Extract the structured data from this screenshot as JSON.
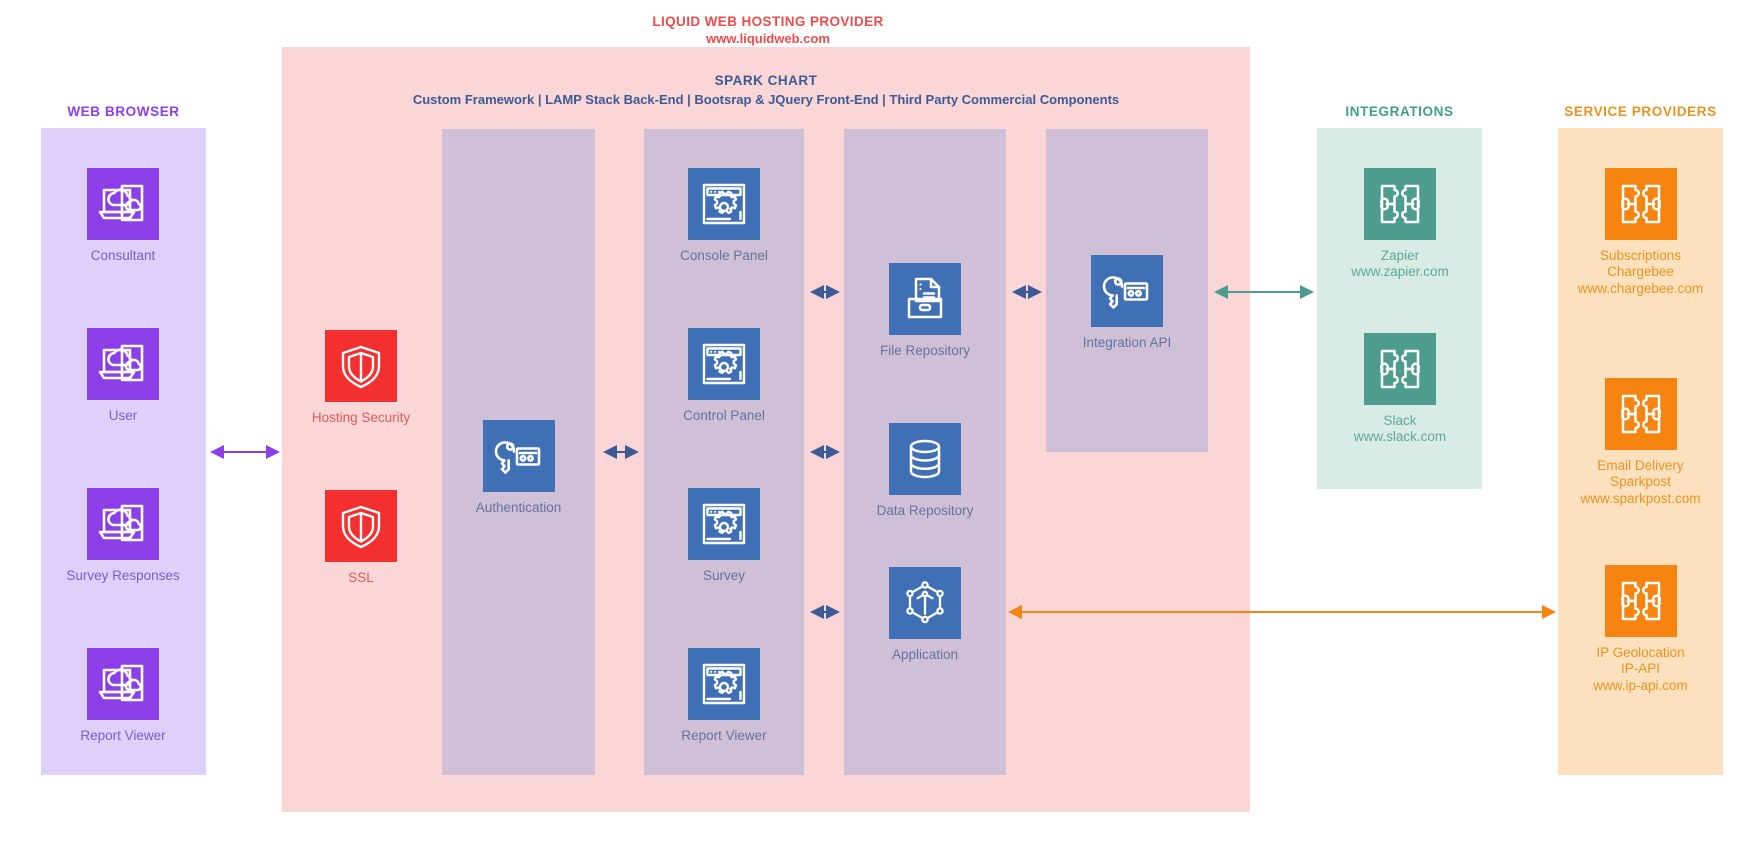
{
  "diagram": {
    "title": "LIQUID WEB HOSTING PROVIDER",
    "subtitle": "www.liquidweb.com",
    "spark_title": "SPARK CHART",
    "spark_subtitle": "Custom Framework | LAMP Stack Back-End | Bootsrap & JQuery Front-End | Third Party Commercial Components"
  },
  "colors": {
    "hosting_provider_bg": "#fbd6d6",
    "hosting_title": "#ef4b4b",
    "browser_header": "#8c3ee8",
    "browser_panel_bg": "#ded0f9",
    "browser_tile": "#8c3ee8",
    "browser_caption": "#7b5bd6",
    "security_tile": "#f42f2f",
    "security_caption": "#e05a5a",
    "spark_panel_bg": "#cfc0d8",
    "spark_tile": "#3f6fb5",
    "spark_caption": "#64739b",
    "spark_title": "#3c5a96",
    "integrations_header": "#3f9e8e",
    "integrations_panel_bg": "#d8ece5",
    "integrations_tile": "#4e9c8e",
    "integrations_caption": "#5fa79a",
    "providers_header": "#e8941f",
    "providers_panel_bg": "#fde0bd",
    "providers_tile": "#f58410",
    "providers_caption": "#e8941f",
    "arrow_purple": "#8c3ee8",
    "arrow_blue": "#3c5a96",
    "arrow_teal": "#4e9c8e",
    "arrow_orange": "#f58410"
  },
  "columns": {
    "web_browser": {
      "header": "WEB BROWSER",
      "nodes": [
        {
          "label": "Consultant",
          "icon": "browser-cloud-icon"
        },
        {
          "label": "User",
          "icon": "browser-cloud-icon"
        },
        {
          "label": "Survey Responses",
          "icon": "browser-cloud-icon"
        },
        {
          "label": "Report Viewer",
          "icon": "browser-cloud-icon"
        }
      ]
    },
    "security": {
      "nodes": [
        {
          "label": "Hosting Security",
          "icon": "shield-icon"
        },
        {
          "label": "SSL",
          "icon": "shield-icon"
        }
      ]
    },
    "auth": {
      "nodes": [
        {
          "label": "Authentication",
          "icon": "key-card-icon"
        }
      ]
    },
    "panels": {
      "nodes": [
        {
          "label": "Console Panel",
          "icon": "window-gear-icon"
        },
        {
          "label": "Control Panel",
          "icon": "window-gear-icon"
        },
        {
          "label": "Survey",
          "icon": "window-gear-icon"
        },
        {
          "label": "Report Viewer",
          "icon": "window-gear-icon"
        }
      ]
    },
    "repositories": {
      "nodes": [
        {
          "label": "File Repository",
          "icon": "file-drawer-icon"
        },
        {
          "label": "Data Repository",
          "icon": "database-icon"
        },
        {
          "label": "Application",
          "icon": "cube-network-icon"
        }
      ]
    },
    "integration_api": {
      "nodes": [
        {
          "label": "Integration API",
          "icon": "key-card-icon"
        }
      ]
    },
    "integrations": {
      "header": "INTEGRATIONS",
      "nodes": [
        {
          "label": "Zapier\nwww.zapier.com",
          "icon": "puzzle-icon"
        },
        {
          "label": "Slack\nwww.slack.com",
          "icon": "puzzle-icon"
        }
      ]
    },
    "service_providers": {
      "header": "SERVICE PROVIDERS",
      "nodes": [
        {
          "label": "Subscriptions\nChargebee\nwww.chargebee.com",
          "icon": "puzzle-icon"
        },
        {
          "label": "Email Delivery\nSparkpost\nwww.sparkpost.com",
          "icon": "puzzle-icon"
        },
        {
          "label": "IP Geolocation\nIP-API\nwww.ip-api.com",
          "icon": "puzzle-icon"
        }
      ]
    }
  }
}
